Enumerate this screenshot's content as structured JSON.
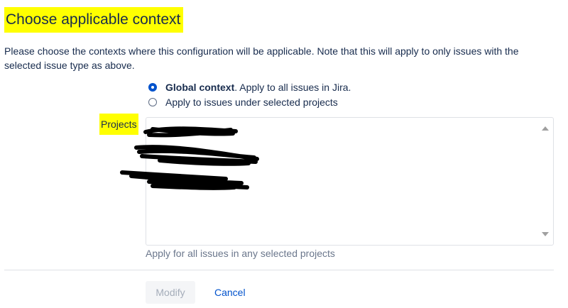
{
  "section": {
    "title": "Choose applicable context",
    "description": "Please choose the contexts where this configuration will be applicable. Note that this will apply to only issues with the selected issue type as above."
  },
  "context_options": [
    {
      "strong": "Global context",
      "rest": ". Apply to all issues in Jira.",
      "checked": true
    },
    {
      "strong": "",
      "rest": "Apply to issues under selected projects",
      "checked": false
    }
  ],
  "projects": {
    "label": "Projects",
    "help": "Apply for all issues in any selected projects"
  },
  "actions": {
    "modify_label": "Modify",
    "cancel_label": "Cancel"
  },
  "colors": {
    "highlight": "#ffff00",
    "link": "#0052cc",
    "text": "#172b4d",
    "muted": "#6b778c"
  }
}
